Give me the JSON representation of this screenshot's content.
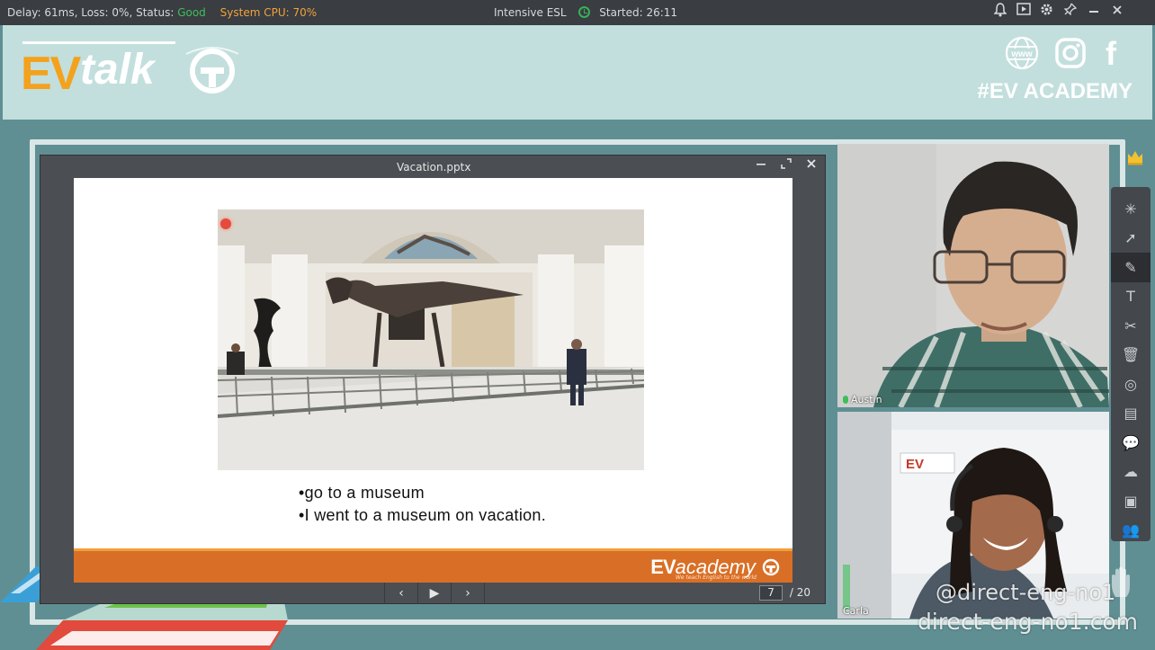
{
  "topbar": {
    "delay_text": "Delay: 61ms, Loss: 0%, Status:",
    "status_text": "Good",
    "cpu_text": "System CPU: 70%",
    "class_name": "Intensive ESL",
    "started_text": "Started: 26:11",
    "icons": [
      "bell-icon",
      "screen-share-icon",
      "settings-icon",
      "pin-icon",
      "minimize-icon",
      "close-icon"
    ],
    "colors": {
      "good": "#3fbf5a",
      "cpu": "#f2a23a"
    }
  },
  "banner": {
    "logo_ev": "EV",
    "logo_talk": "talk",
    "social_icons": [
      "www-icon",
      "instagram-icon",
      "facebook-icon"
    ],
    "www_text": "www",
    "facebook_glyph": "f",
    "hashtag": "#EV ACADEMY"
  },
  "presentation": {
    "title": "Vacation.pptx",
    "slide": {
      "bullets": [
        "•go to a museum",
        "•I went to a museum on vacation."
      ],
      "footer_brand_a": "EV",
      "footer_brand_b": "academy",
      "footer_tagline": "We teach English to the world"
    },
    "nav": {
      "prev": "‹",
      "play": "▶",
      "next": "›"
    },
    "current_page": "7",
    "total_pages": "/ 20"
  },
  "participants": [
    {
      "name": "Austin"
    },
    {
      "name": "Carla"
    }
  ],
  "toolbar": {
    "tools": [
      "laser-pointer-icon",
      "select-move-icon",
      "pen-icon",
      "text-icon",
      "scissors-icon",
      "trash-icon",
      "audio-icon",
      "notes-icon",
      "chat-icon",
      "cloud-icon",
      "toolbox-icon",
      "users-icon"
    ],
    "glyphs": [
      "✳",
      "➚",
      "✎",
      "T",
      "✂",
      "🗑",
      "◎",
      "▤",
      "💬",
      "☁",
      "▣",
      "👥"
    ],
    "active_index": 2
  },
  "watermark": {
    "line1": "@direct-eng-no1",
    "line2": "direct-eng-no1.com"
  }
}
